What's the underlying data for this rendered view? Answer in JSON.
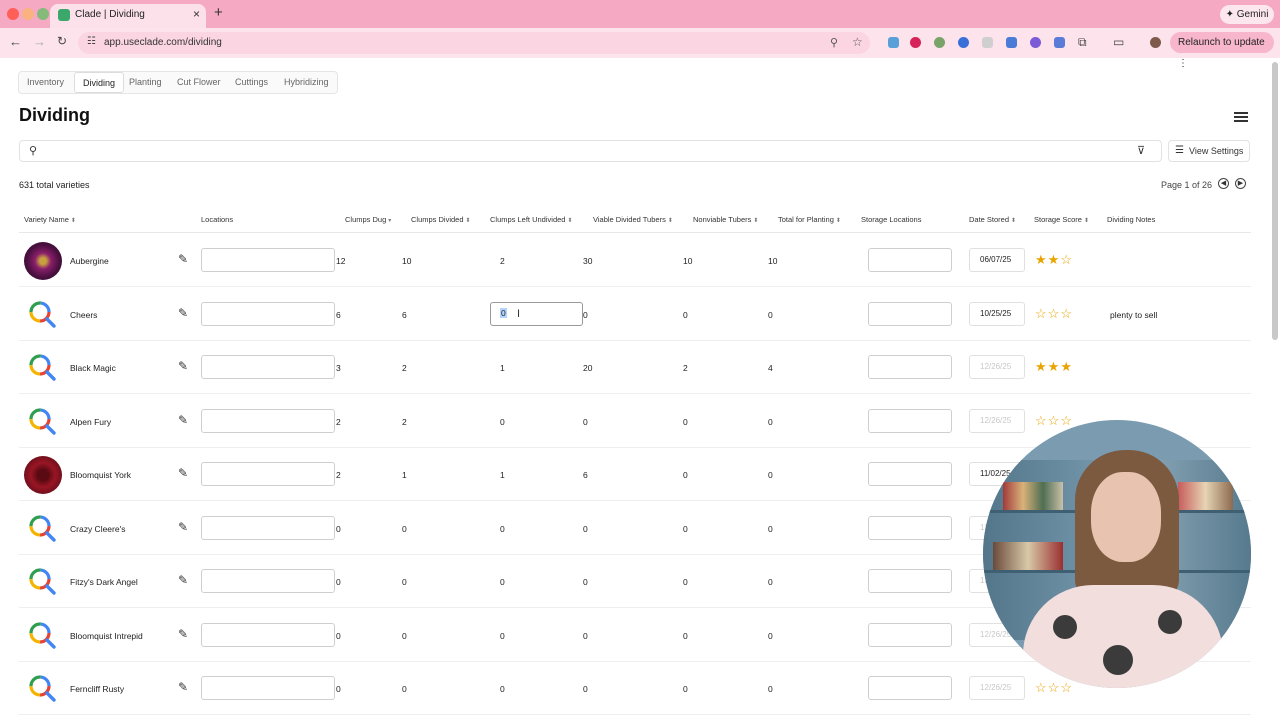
{
  "browser": {
    "tab_title": "Clade | Dividing",
    "url": "app.useclade.com/dividing",
    "gemini_label": "Gemini",
    "relaunch_label": "Relaunch to update",
    "new_tab_label": "+",
    "close_tab_label": "×"
  },
  "app": {
    "tabs": [
      "Inventory",
      "Dividing",
      "Planting",
      "Cut Flower",
      "Cuttings",
      "Hybridizing"
    ],
    "active_tab": "Dividing",
    "page_title": "Dividing",
    "view_settings_label": "View Settings",
    "total_label": "631 total varieties",
    "pager_label": "Page 1 of 26"
  },
  "columns": {
    "variety": "Variety Name",
    "locations": "Locations",
    "clumps_dug": "Clumps Dug",
    "clumps_divided": "Clumps Divided",
    "clumps_left": "Clumps Left Undivided",
    "viable": "Viable Divided Tubers",
    "nonviable": "Nonviable Tubers",
    "total": "Total for Planting",
    "storage_loc": "Storage Locations",
    "date": "Date Stored",
    "score": "Storage Score",
    "notes": "Dividing Notes"
  },
  "rows": [
    {
      "name": "Aubergine",
      "dug": "12",
      "divided": "10",
      "left": "2",
      "viable": "30",
      "nonviable": "10",
      "total": "10",
      "date": "06/07/25",
      "score": 2,
      "notes": "",
      "avatar": "photo-purple"
    },
    {
      "name": "Cheers",
      "dug": "6",
      "divided": "6",
      "left": "0",
      "viable": "0",
      "nonviable": "0",
      "total": "0",
      "date": "10/25/25",
      "score": 0,
      "notes": "plenty to sell",
      "avatar": "placeholder",
      "editing": true
    },
    {
      "name": "Black Magic",
      "dug": "3",
      "divided": "2",
      "left": "1",
      "viable": "20",
      "nonviable": "2",
      "total": "4",
      "date": "12/26/25",
      "score": 3,
      "notes": "",
      "avatar": "placeholder"
    },
    {
      "name": "Alpen Fury",
      "dug": "2",
      "divided": "2",
      "left": "0",
      "viable": "0",
      "nonviable": "0",
      "total": "0",
      "date": "12/26/25",
      "score": 0,
      "notes": "",
      "avatar": "placeholder"
    },
    {
      "name": "Bloomquist York",
      "dug": "2",
      "divided": "1",
      "left": "1",
      "viable": "6",
      "nonviable": "0",
      "total": "0",
      "date": "11/02/25",
      "score": 0,
      "notes": "",
      "avatar": "photo-red"
    },
    {
      "name": "Crazy Cleere's",
      "dug": "0",
      "divided": "0",
      "left": "0",
      "viable": "0",
      "nonviable": "0",
      "total": "0",
      "date": "12/26/25",
      "score": 0,
      "notes": "",
      "avatar": "placeholder"
    },
    {
      "name": "Fitzy's Dark Angel",
      "dug": "0",
      "divided": "0",
      "left": "0",
      "viable": "0",
      "nonviable": "0",
      "total": "0",
      "date": "12/26/25",
      "score": 0,
      "notes": "",
      "avatar": "placeholder"
    },
    {
      "name": "Bloomquist Intrepid",
      "dug": "0",
      "divided": "0",
      "left": "0",
      "viable": "0",
      "nonviable": "0",
      "total": "0",
      "date": "12/26/25",
      "score": 0,
      "notes": "",
      "avatar": "placeholder"
    },
    {
      "name": "Ferncliff Rusty",
      "dug": "0",
      "divided": "0",
      "left": "0",
      "viable": "0",
      "nonviable": "0",
      "total": "0",
      "date": "12/26/25",
      "score": 0,
      "notes": "",
      "avatar": "placeholder"
    }
  ],
  "colors": {
    "chrome_pink": "#f5a9c3",
    "star": "#e9a400",
    "placeholder_red": "#e54335",
    "placeholder_yellow": "#f4b400",
    "placeholder_green": "#2e9e4f",
    "placeholder_blue": "#4285f4"
  }
}
